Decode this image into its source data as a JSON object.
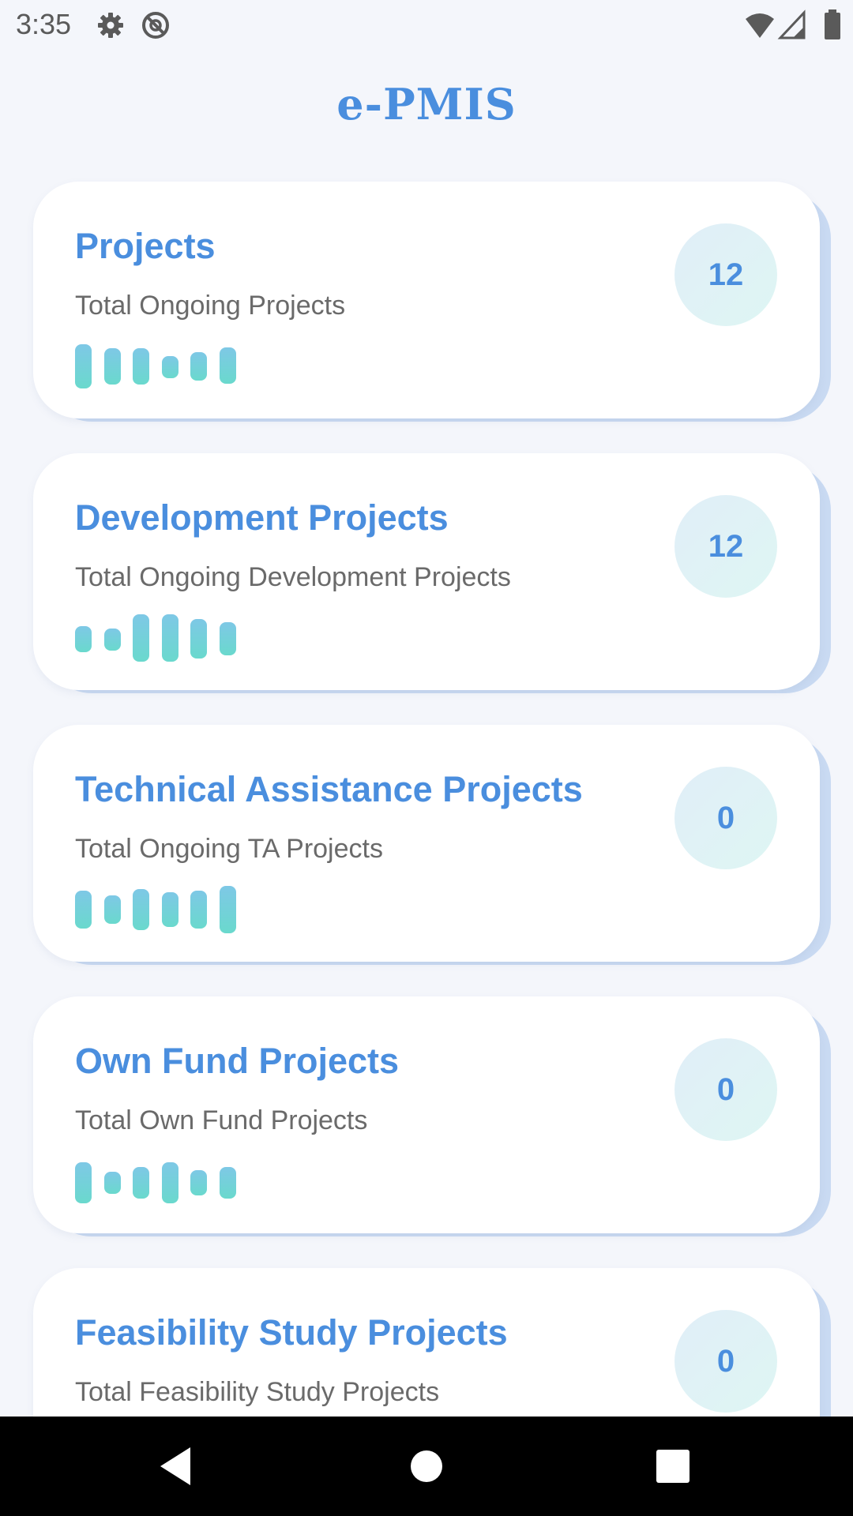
{
  "status_bar": {
    "time": "3:35",
    "icons": [
      "gear-icon",
      "no-tracking-icon",
      "wifi-icon",
      "signal-icon",
      "battery-icon"
    ]
  },
  "app": {
    "title": "e-PMIS"
  },
  "cards": [
    {
      "title": "Projects",
      "subtitle": "Total Ongoing Projects",
      "count": "12"
    },
    {
      "title": "Development Projects",
      "subtitle": "Total Ongoing Development Projects",
      "count": "12"
    },
    {
      "title": "Technical Assistance Projects",
      "subtitle": "Total Ongoing TA Projects",
      "count": "0"
    },
    {
      "title": "Own Fund Projects",
      "subtitle": "Total Own Fund Projects",
      "count": "0"
    },
    {
      "title": "Feasibility Study Projects",
      "subtitle": "Total Feasibility Study Projects",
      "count": "0"
    }
  ],
  "nav_bar": {
    "buttons": [
      "back-icon",
      "home-icon",
      "recents-icon"
    ]
  },
  "colors": {
    "accent": "#4a8ede",
    "background": "#f4f6fb",
    "card": "#ffffff",
    "card_shadow": "#c9daf2",
    "bar_top": "#7ec8e6",
    "bar_bottom": "#6ad9cd"
  }
}
